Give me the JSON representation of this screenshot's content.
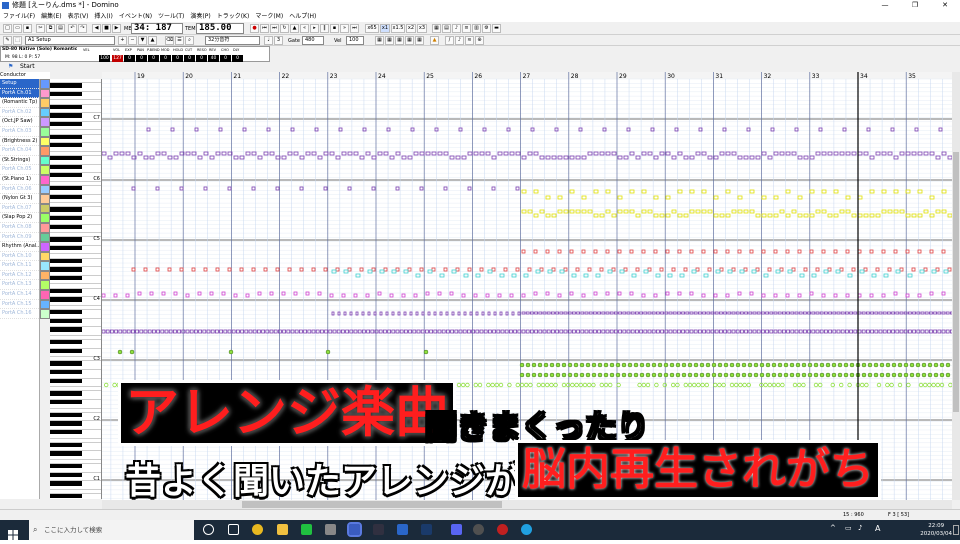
{
  "window": {
    "title": "修題 [えーりん.dms *] - Domino",
    "controls": [
      "—",
      "❐",
      "✕"
    ]
  },
  "menu": [
    "ファイル(F)",
    "編集(E)",
    "表示(V)",
    "挿入(I)",
    "イベント(N)",
    "ツール(T)",
    "演奏(P)",
    "トラック(K)",
    "マーク(M)",
    "ヘルプ(H)"
  ],
  "toolbar": {
    "position": "34: 187",
    "tempo_label": "TEMPO",
    "tempo": "185.00",
    "meas_label": "MEAS",
    "speed_buttons": [
      "x65",
      "x1",
      "x1.5",
      "x2",
      "x3"
    ],
    "track_select": "A1 Setup",
    "grid_select": "32分音符",
    "gate_label": "Gate",
    "gate_value": "480",
    "vel_label": "Vel",
    "vel_value": "100"
  },
  "mixer": {
    "instrument": "SD-80 Native (Solo) Romantic",
    "headers": [
      "VEL",
      "VOL",
      "EXP",
      "PAN",
      "P.BEND",
      "MOD",
      "HOLD",
      "CUT",
      "RESO",
      "REV",
      "CHO",
      "DLY"
    ],
    "values": [
      "100",
      "127",
      "0",
      "0",
      "0",
      "0",
      "0",
      "0",
      "0",
      "40",
      "0",
      "0"
    ],
    "meas_row": [
      "M:",
      "98",
      "L:",
      "0",
      "P:",
      "57"
    ]
  },
  "start_label": "Start",
  "conductor_label": "Conductor",
  "tracks": [
    {
      "label": "Setup",
      "dim": false,
      "sel": true
    },
    {
      "label": "PortA Ch.01",
      "dim": true,
      "sel": true
    },
    {
      "label": "(Romantic Tp)",
      "dim": false,
      "sel": false
    },
    {
      "label": "PortA Ch.02",
      "dim": true,
      "sel": false
    },
    {
      "label": "(Oct.JP Saw)",
      "dim": false,
      "sel": false
    },
    {
      "label": "PortA Ch.03",
      "dim": true,
      "sel": false
    },
    {
      "label": "(Brightness 2)",
      "dim": false,
      "sel": false
    },
    {
      "label": "PortA Ch.04",
      "dim": true,
      "sel": false
    },
    {
      "label": "(St.Strings)",
      "dim": false,
      "sel": false
    },
    {
      "label": "PortA Ch.05",
      "dim": true,
      "sel": false
    },
    {
      "label": "(St.Piano 1)",
      "dim": false,
      "sel": false
    },
    {
      "label": "PortA Ch.06",
      "dim": true,
      "sel": false
    },
    {
      "label": "(Nylon Gt 3)",
      "dim": false,
      "sel": false
    },
    {
      "label": "PortA Ch.07",
      "dim": true,
      "sel": false
    },
    {
      "label": "(Slap Pop 2)",
      "dim": false,
      "sel": false
    },
    {
      "label": "PortA Ch.08",
      "dim": true,
      "sel": false
    },
    {
      "label": "PortA Ch.09",
      "dim": true,
      "sel": false
    },
    {
      "label": "Rhythm (Anal...",
      "dim": false,
      "sel": false
    },
    {
      "label": "PortA Ch.10",
      "dim": true,
      "sel": false
    },
    {
      "label": "PortA Ch.11",
      "dim": true,
      "sel": false
    },
    {
      "label": "PortA Ch.12",
      "dim": true,
      "sel": false
    },
    {
      "label": "PortA Ch.13",
      "dim": true,
      "sel": false
    },
    {
      "label": "PortA Ch.14",
      "dim": true,
      "sel": false
    },
    {
      "label": "PortA Ch.15",
      "dim": true,
      "sel": false
    },
    {
      "label": "PortA Ch.16",
      "dim": true,
      "sel": false
    }
  ],
  "octaves": [
    "C7",
    "C6",
    "C5",
    "C4",
    "C3",
    "C2",
    "C1"
  ],
  "measures": [
    "19",
    "20",
    "21",
    "22",
    "23",
    "24",
    "25",
    "26",
    "27",
    "28",
    "29",
    "30",
    "31",
    "32",
    "33",
    "34",
    "35"
  ],
  "status": {
    "left": "",
    "right1": "15 : 960",
    "right2": "F 3 [ 53]"
  },
  "taskbar": {
    "search_placeholder": "ここに入力して検索",
    "time": "22:09",
    "date": "2020/03/04",
    "ime": "A"
  },
  "captions": {
    "line1_big": "アレンジ楽曲",
    "line1_small": "聞きまくったり",
    "line2_white": "昔よく聞いたアレンジが",
    "line2_red": "脳内再生されがち"
  },
  "colors": {
    "note_purple": "#7b3fb0",
    "note_yellow": "#e0e000",
    "note_red": "#e04040",
    "note_cyan": "#40d0d0",
    "note_magenta": "#d040d0",
    "note_green": "#90e040",
    "caption_red": "#ff1e1e"
  }
}
